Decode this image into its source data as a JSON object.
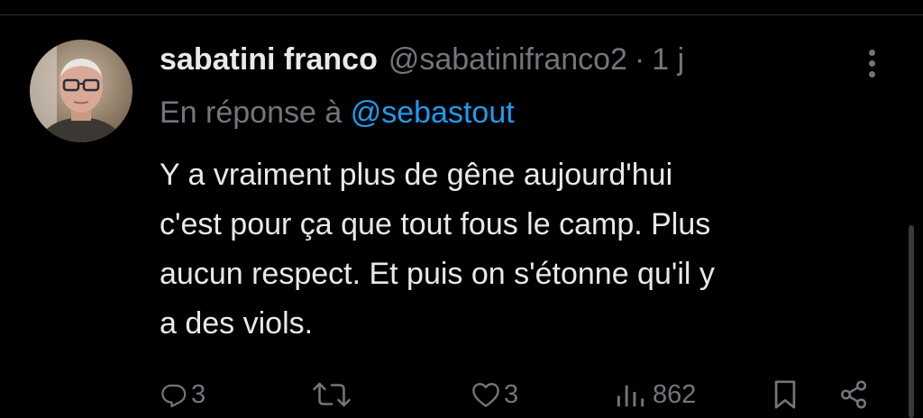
{
  "colors": {
    "background": "#000000",
    "text_primary": "#e7e9ea",
    "text_secondary": "#71767b",
    "accent": "#1d9bf0",
    "divider": "#2f3336"
  },
  "tweet": {
    "author": {
      "display_name": "sabatini franco",
      "handle": "@sabatinifranco2",
      "avatar_icon": "user-avatar-photo"
    },
    "separator": "·",
    "time": "1 j",
    "reply": {
      "prefix": "En réponse à",
      "mention": "@sebastout"
    },
    "text_lines": [
      "Y a vraiment plus de gêne aujourd'hui",
      "c'est pour ça que tout fous le camp. Plus",
      "aucun respect. Et puis on s'étonne qu'il y",
      "a des viols."
    ],
    "actions": {
      "replies": {
        "icon": "reply-icon",
        "count": "3"
      },
      "retweets": {
        "icon": "retweet-icon",
        "count": ""
      },
      "likes": {
        "icon": "like-icon",
        "count": "3"
      },
      "views": {
        "icon": "views-icon",
        "count": "862"
      },
      "bookmark": {
        "icon": "bookmark-icon"
      },
      "share": {
        "icon": "share-icon"
      }
    }
  }
}
